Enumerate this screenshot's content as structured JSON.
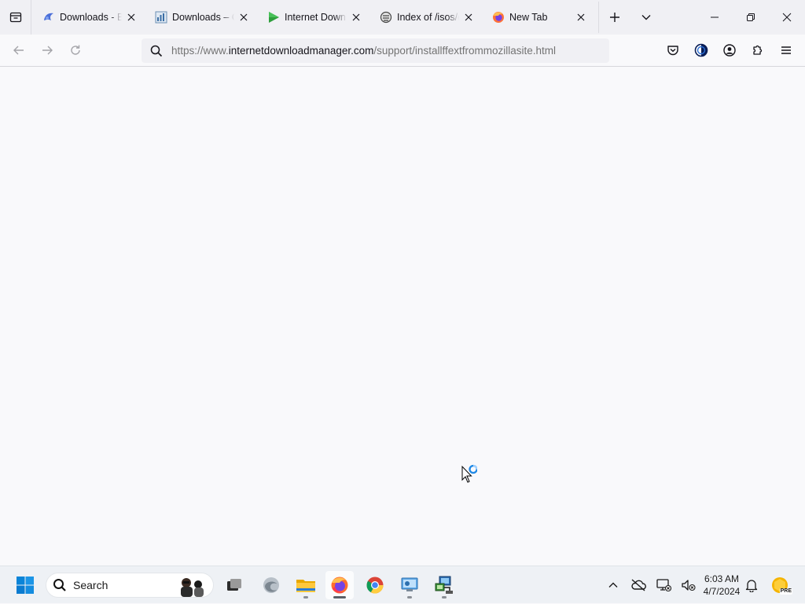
{
  "browser": {
    "tabs": [
      {
        "title": "Downloads - Boi",
        "favicon": "blue-spiral-icon",
        "close_label": "✕"
      },
      {
        "title": "Downloads – Or",
        "favicon": "chart-icon",
        "close_label": "✕"
      },
      {
        "title": "Internet Downlo",
        "favicon": "green-play-icon",
        "close_label": "✕"
      },
      {
        "title": "Index of /isos/d",
        "favicon": "server-icon",
        "close_label": "✕"
      },
      {
        "title": "New Tab",
        "favicon": "firefox-icon",
        "close_label": "✕",
        "selected": true
      }
    ],
    "url": {
      "prefix": "https://www.",
      "domain": "internetdownloadmanager.com",
      "path": "/support/installffextfrommozillasite.html"
    }
  },
  "taskbar": {
    "search_label": "Search",
    "pinned": [
      "start-button",
      "search",
      "task-view",
      "edge",
      "file-explorer",
      "firefox",
      "chrome",
      "control-panel",
      "network-setup"
    ],
    "active_app": "firefox",
    "clock": {
      "time": "6:03 AM",
      "date": "4/7/2024"
    },
    "tray_badge": "PRE"
  },
  "colors": {
    "accent": "#0061e0",
    "page_bg": "#f9f9fb",
    "tabstrip_bg": "#f0f0f4",
    "taskbar_bg": "#eef1f5",
    "windows_blue": "#0a84d8"
  }
}
